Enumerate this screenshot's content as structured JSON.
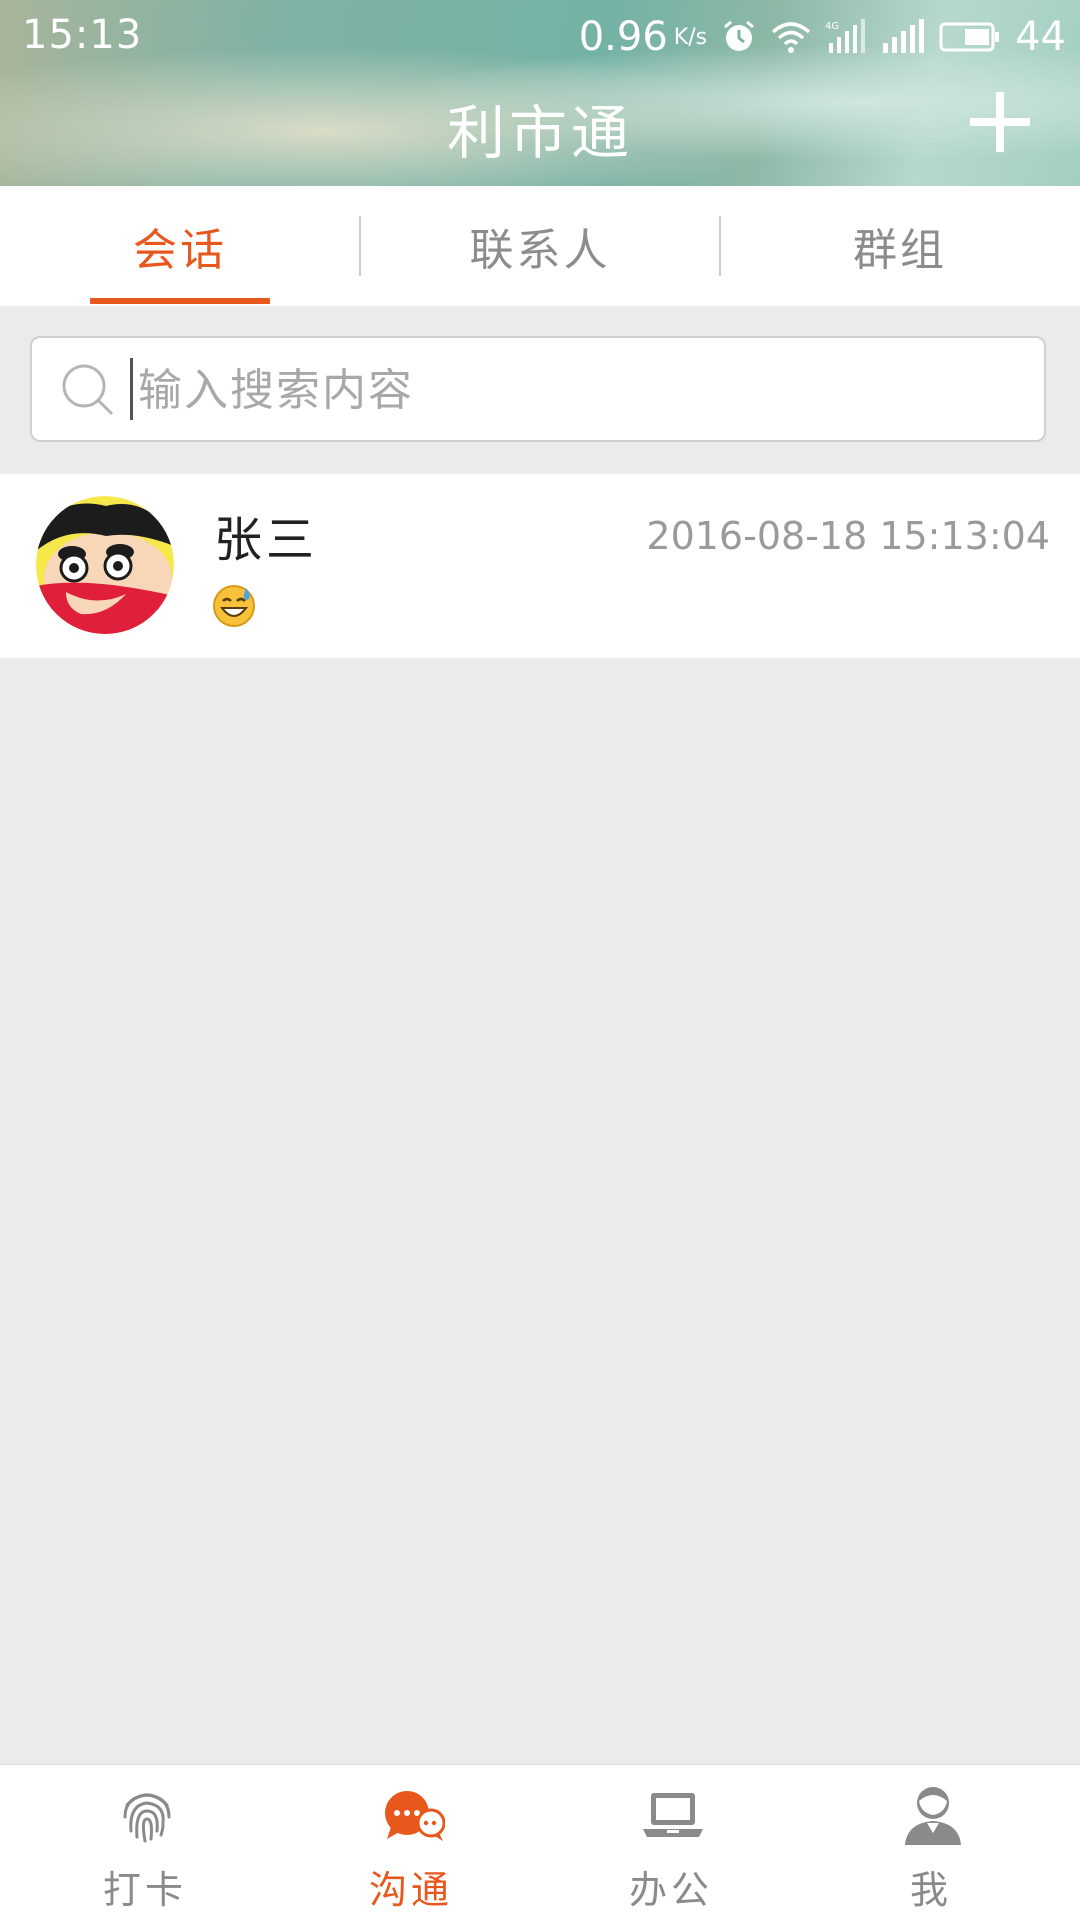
{
  "status_bar": {
    "time": "15:13",
    "speed": "0.96",
    "speed_unit": "K/s",
    "battery": "44"
  },
  "header": {
    "title": "利市通",
    "add_icon": "plus-icon"
  },
  "tabs": [
    {
      "label": "会话",
      "active": true
    },
    {
      "label": "联系人",
      "active": false
    },
    {
      "label": "群组",
      "active": false
    }
  ],
  "search": {
    "placeholder": "输入搜索内容",
    "value": ""
  },
  "conversations": [
    {
      "name": "张三",
      "time": "2016-08-18 15:13:04",
      "last_message_icon": "sweat-smile-emoji"
    }
  ],
  "bottom_nav": [
    {
      "label": "打卡",
      "icon": "fingerprint-icon",
      "active": false
    },
    {
      "label": "沟通",
      "icon": "chat-bubbles-icon",
      "active": true
    },
    {
      "label": "办公",
      "icon": "laptop-icon",
      "active": false
    },
    {
      "label": "我",
      "icon": "person-icon",
      "active": false
    }
  ],
  "colors": {
    "accent": "#e8581d",
    "background": "#ebebeb",
    "inactive_text": "#8c8c8c"
  }
}
